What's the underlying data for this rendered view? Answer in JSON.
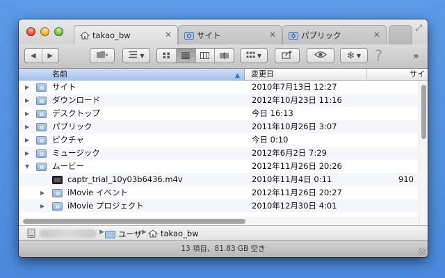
{
  "tabs": [
    {
      "label": "takao_bw",
      "icon": "home-icon",
      "active": true
    },
    {
      "label": "サイト",
      "icon": "sites-folder-icon",
      "active": false
    },
    {
      "label": "パブリック",
      "icon": "public-folder-icon",
      "active": false
    }
  ],
  "toolbar": {
    "back": "◀",
    "forward": "▶",
    "help": "?",
    "more": "»"
  },
  "columns": {
    "name": "名前",
    "date": "変更日",
    "size": "サイ"
  },
  "rows": [
    {
      "name": "サイト",
      "date": "2010年7月13日 12:27",
      "size": "",
      "level": 0,
      "expanded": false,
      "icon": "sites-folder-icon"
    },
    {
      "name": "ダウンロード",
      "date": "2012年10月23日 11:16",
      "size": "",
      "level": 0,
      "expanded": false,
      "icon": "downloads-folder-icon"
    },
    {
      "name": "デスクトップ",
      "date": "今日 16:13",
      "size": "",
      "level": 0,
      "expanded": false,
      "icon": "desktop-folder-icon"
    },
    {
      "name": "パブリック",
      "date": "2011年10月26日 3:07",
      "size": "",
      "level": 0,
      "expanded": false,
      "icon": "public-folder-icon"
    },
    {
      "name": "ピクチャ",
      "date": "今日 0:10",
      "size": "",
      "level": 0,
      "expanded": false,
      "icon": "pictures-folder-icon"
    },
    {
      "name": "ミュージック",
      "date": "2012年6月2日 7:29",
      "size": "",
      "level": 0,
      "expanded": false,
      "icon": "music-folder-icon"
    },
    {
      "name": "ムービー",
      "date": "2012年11月26日 20:26",
      "size": "",
      "level": 0,
      "expanded": true,
      "icon": "movies-folder-icon"
    },
    {
      "name": "captr_trial_10y03b6436.m4v",
      "date": "2010年11月4日 0:11",
      "size": "910",
      "level": 1,
      "expanded": false,
      "icon": "video-file-icon"
    },
    {
      "name": "iMovie イベント",
      "date": "2012年11月26日 20:27",
      "size": "",
      "level": 1,
      "expanded": false,
      "icon": "folder-icon"
    },
    {
      "name": "iMovie プロジェクト",
      "date": "2010年12月30日 4:01",
      "size": "",
      "level": 1,
      "expanded": false,
      "icon": "folder-icon"
    }
  ],
  "pathbar": {
    "users": "ユーザ",
    "home": "takao_bw"
  },
  "status": "13 項目、81.83 GB 空き"
}
